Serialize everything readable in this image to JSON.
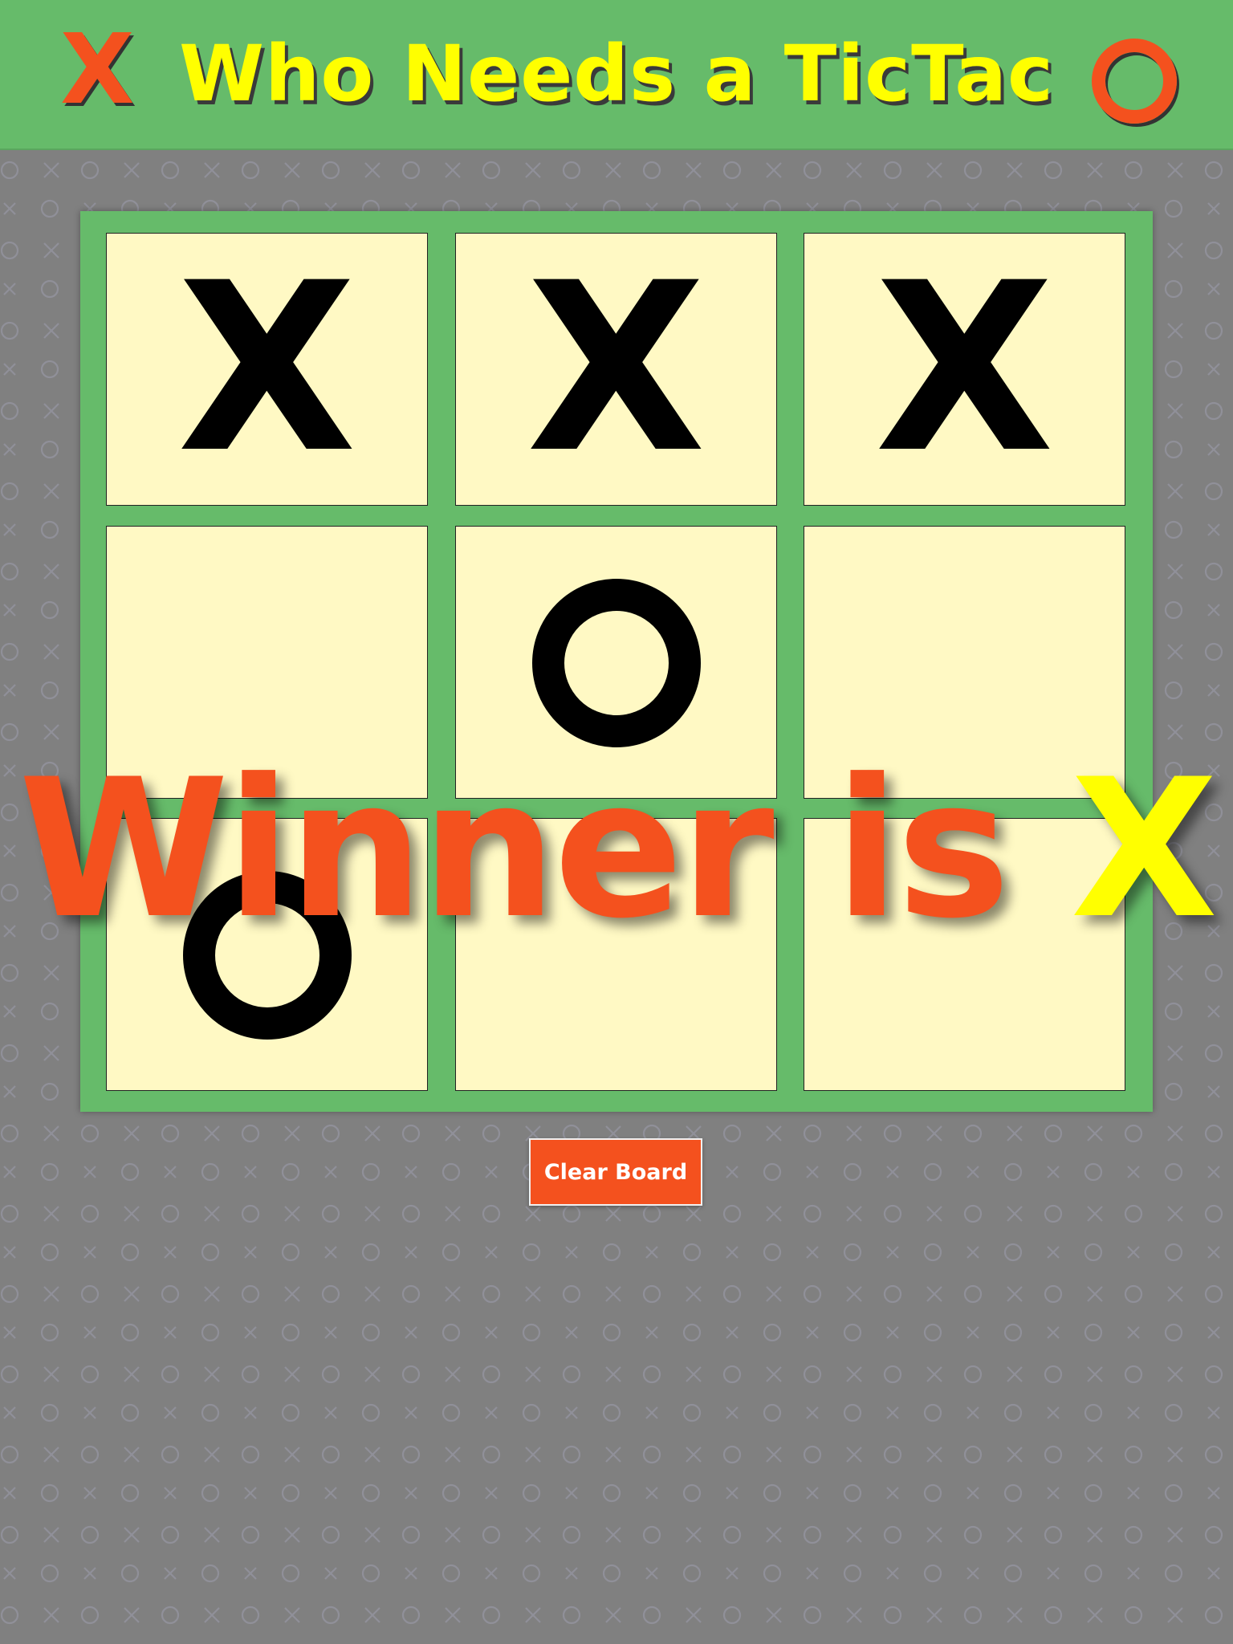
{
  "header": {
    "title": "Who Needs a TicTac",
    "left_symbol": "X",
    "right_symbol": "O"
  },
  "board": {
    "cells": [
      {
        "mark": "X"
      },
      {
        "mark": "X"
      },
      {
        "mark": "X"
      },
      {
        "mark": ""
      },
      {
        "mark": "O"
      },
      {
        "mark": ""
      },
      {
        "mark": "O"
      },
      {
        "mark": ""
      },
      {
        "mark": ""
      }
    ]
  },
  "result": {
    "prefix": "Winner is",
    "winner": "X"
  },
  "controls": {
    "clear_label": "Clear Board"
  },
  "colors": {
    "background": "#808080",
    "header_bg": "#66bb6a",
    "title": "#ffff00",
    "accent": "#f4511e",
    "cell_bg": "#fff9c4",
    "mark": "#000000"
  }
}
